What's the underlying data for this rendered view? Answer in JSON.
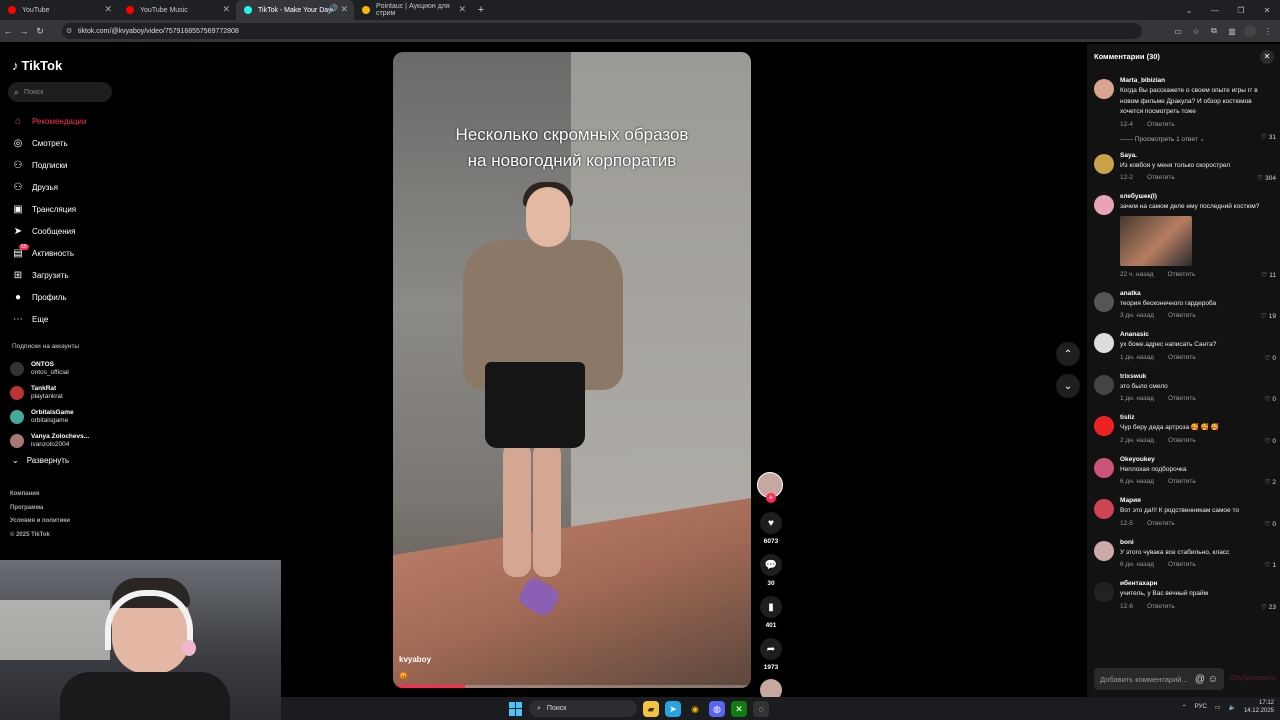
{
  "browser": {
    "tabs": [
      {
        "label": "YouTube",
        "color": "#ff0000",
        "active": false
      },
      {
        "label": "YouTube Music",
        "color": "#ff0000",
        "active": false
      },
      {
        "label": "TikTok - Make Your Day",
        "color": "#25f4ee",
        "active": true
      },
      {
        "label": "Pointauc | Аукцион для стрим",
        "color": "#ffb400",
        "active": false
      }
    ],
    "url": "tiktok.com/@kvyaboy/video/7579168557569772808"
  },
  "sidebar": {
    "logo": "TikTok",
    "search_placeholder": "Поиск",
    "nav": [
      {
        "label": "Рекомендации",
        "icon": "home-icon",
        "glyph": "⌂"
      },
      {
        "label": "Смотреть",
        "icon": "compass-icon",
        "glyph": "◎"
      },
      {
        "label": "Подписки",
        "icon": "following-icon",
        "glyph": "⚇"
      },
      {
        "label": "Друзья",
        "icon": "friends-icon",
        "glyph": "⚇"
      },
      {
        "label": "Трансляция",
        "icon": "live-icon",
        "glyph": "▣"
      },
      {
        "label": "Сообщения",
        "icon": "messages-icon",
        "glyph": "➤"
      },
      {
        "label": "Активность",
        "icon": "activity-icon",
        "glyph": "▤",
        "badge": "59"
      },
      {
        "label": "Загрузить",
        "icon": "upload-icon",
        "glyph": "⊞"
      },
      {
        "label": "Профиль",
        "icon": "profile-icon",
        "glyph": "●"
      },
      {
        "label": "Еще",
        "icon": "more-icon",
        "glyph": "⋯"
      }
    ],
    "following_title": "Подписки на аккаунты",
    "following": [
      {
        "name": "ONTOS",
        "handle": "ontos_official",
        "color": "#333"
      },
      {
        "name": "TankRat",
        "handle": "playtankrat",
        "color": "#b33"
      },
      {
        "name": "OrbitalsGame",
        "handle": "orbitalsgame",
        "color": "#4a9"
      },
      {
        "name": "Vanya Zolochevs...",
        "handle": "ivanzolo2004",
        "color": "#a77"
      }
    ],
    "expand_label": "Развернуть",
    "footer": [
      "Компания",
      "Программа",
      "Условия и политики",
      "© 2025 TikTok"
    ]
  },
  "video": {
    "caption_line1": "Несколько скромных образов",
    "caption_line2": "на новогодний корпоратив",
    "author": "kvyaboy",
    "emoji": "😡",
    "progress": 0.2
  },
  "actions": {
    "likes": "6073",
    "comments": "30",
    "saves": "401",
    "shares": "1973"
  },
  "comments": {
    "title": "Комментарии (30)",
    "items": [
      {
        "user": "Marta_bibizian",
        "text": "Когда Вы расскажете о своем опыте игры гг в новом фильме Дракула? И обзор костюмов хочется посмотреть тоже",
        "date": "12-4",
        "likes": "31",
        "color": "#d9a48f",
        "more": "Просмотреть 1 ответ"
      },
      {
        "user": "Saya.",
        "text": "Из ковбоя у меня только скорострел",
        "date": "12-2",
        "likes": "304",
        "color": "#c9a24a"
      },
      {
        "user": "клебушек(I)",
        "text": "зачем на самом деле ему последний костюм?",
        "date": "22 ч. назад",
        "likes": "11",
        "color": "#e8a4b4",
        "image": true
      },
      {
        "user": "anatka",
        "text": "теория бесконечного гардероба",
        "date": "3 дн. назад",
        "likes": "19",
        "color": "#555"
      },
      {
        "user": "Ananasic",
        "text": "ух боже.адрес написать Санта?",
        "date": "1 дн. назад",
        "likes": "0",
        "color": "#ddd"
      },
      {
        "user": "trixswuk",
        "text": "это было смело",
        "date": "1 дн. назад",
        "likes": "0",
        "color": "#444"
      },
      {
        "user": "tisliz",
        "text": "Чур беру деда артроза 🥰 🥰 🥰",
        "date": "2 дн. назад",
        "likes": "0",
        "color": "#e22"
      },
      {
        "user": "Okeyoukey",
        "text": "Неплохая подборочка",
        "date": "6 дн. назад",
        "likes": "2",
        "color": "#c57"
      },
      {
        "user": "Мария",
        "text": "Вот это да!!! К родственникам самое то",
        "date": "12-5",
        "likes": "0",
        "color": "#c45"
      },
      {
        "user": "boni",
        "text": "У этого чувака все стабильно, класс",
        "date": "6 дн. назад",
        "likes": "1",
        "color": "#caa"
      },
      {
        "user": "ибентахарн",
        "text": "учитель, у Вас вечный прайм",
        "date": "12-6",
        "likes": "23",
        "color": "#222"
      }
    ],
    "reply_label": "Ответить",
    "add_placeholder": "Добавить комментарий...",
    "post_label": "Опубликовать"
  },
  "taskbar": {
    "search": "Поиск",
    "lang": "РУС",
    "time": "17:12",
    "date": "14.12.2025"
  }
}
